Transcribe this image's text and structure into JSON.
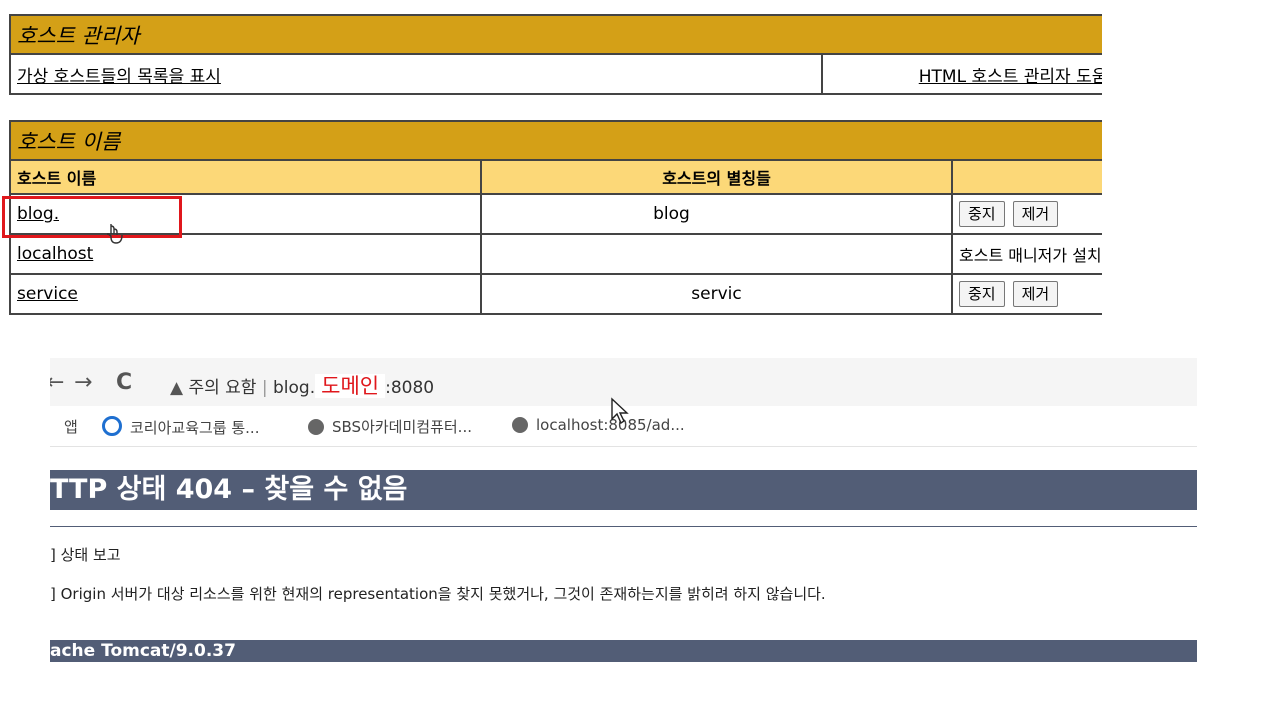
{
  "host_manager": {
    "title": "호스트 관리자",
    "list_link": "가상 호스트들의 목록을 표시",
    "right_link": "HTML 호스트 관리자 도움말"
  },
  "hosts_table": {
    "section_title": "호스트 이름",
    "col_name": "호스트 이름",
    "col_aliases": "호스트의 별칭들",
    "rows": [
      {
        "name": "blog.",
        "alias": "blog",
        "stop": "중지",
        "remove": "제거"
      },
      {
        "name": "localhost",
        "alias": "",
        "status": "호스트 매니저가 설치된 호스트"
      },
      {
        "name": "service",
        "alias": "servic",
        "stop": "중지",
        "remove": "제거"
      }
    ]
  },
  "browser": {
    "back_arrow": "←",
    "forward_arrow": "→",
    "reload": "C",
    "warning_text": "주의 요함",
    "separator": "|",
    "url_prefix": "blog.",
    "domain_label": "도메인",
    "url_suffix": ":8080",
    "bookmarks": [
      {
        "label": "앱"
      },
      {
        "label": "코리아교육그룹 통..."
      },
      {
        "label": "SBS아카데미컴퓨터..."
      },
      {
        "label": "localhost:8085/ad..."
      }
    ],
    "page_title": "TTP 상태 404 – 찾을 수 없음",
    "line1": "] 상태 보고",
    "line2": "] Origin 서버가 대상 리소스를 위한 현재의 representation을 찾지 못했거나, 그것이 존재하는지를 밝히려 하지 않습니다.",
    "footer": "ache Tomcat/9.0.37"
  },
  "colors": {
    "header_dark": "#d4a017",
    "header_light": "#fcd878",
    "highlight_red": "#e0171c",
    "tomcat_slate": "#525d76"
  }
}
